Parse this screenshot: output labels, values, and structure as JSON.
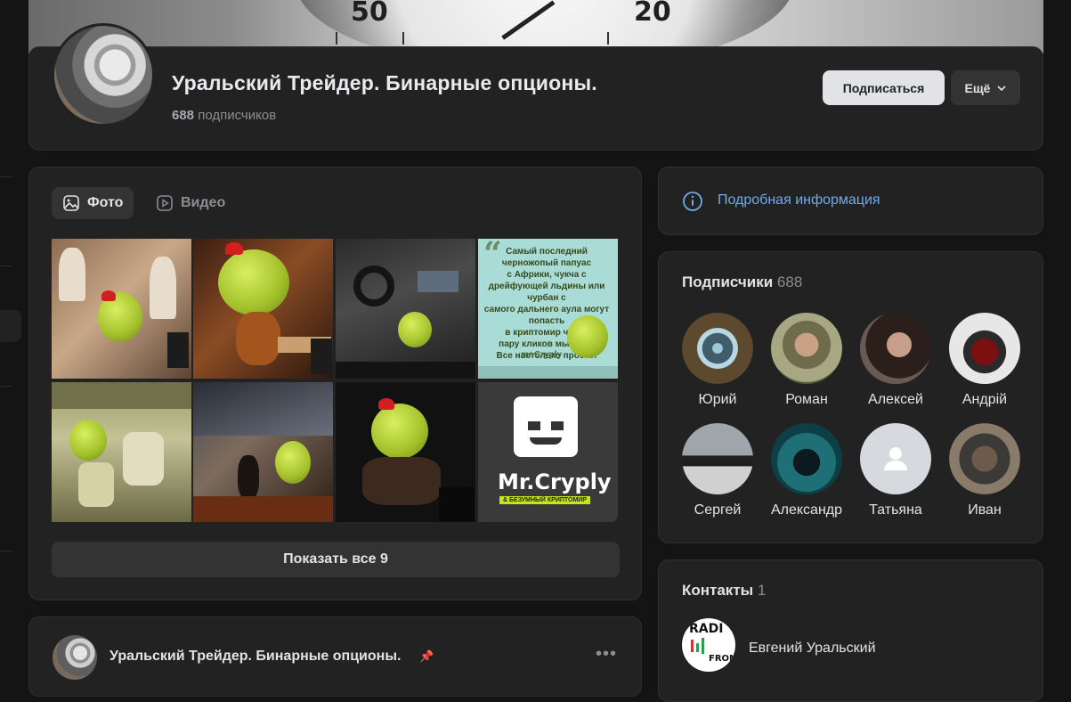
{
  "group": {
    "title": "Уральский Трейдер. Бинарные опционы.",
    "subscribers_count": "688",
    "subscribers_label": "подписчиков",
    "subscribe_button": "Подписаться",
    "more_button": "Ещё"
  },
  "cover": {
    "dial_numbers": [
      "50",
      "20"
    ]
  },
  "media": {
    "tabs": [
      {
        "label": "Фото",
        "icon": "image-icon",
        "active": true
      },
      {
        "label": "Видео",
        "icon": "play-icon",
        "active": false
      }
    ],
    "quote_text": "Самый последний\nчерножопый папуас\nс Африки, чукча с\nдрейфующей льдины или чурбан с\nсамого дальнего аула могут попасть\nв криптомир через\nпару кликов мышкой.\nВсе настолько просто!",
    "quote_sign": "mr.Cryply",
    "logo_text": "Mr.Cryply",
    "logo_sub": "& БЕЗУМНЫЙ КРИПТОМИР",
    "show_all": "Показать все 9"
  },
  "post": {
    "author": "Уральский Трейдер. Бинарные опционы."
  },
  "info": {
    "link": "Подробная информация"
  },
  "members": {
    "title": "Подписчики",
    "count": "688",
    "items": [
      {
        "name": "Юрий"
      },
      {
        "name": "Роман"
      },
      {
        "name": "Алексей"
      },
      {
        "name": "Андрій"
      },
      {
        "name": "Сергей"
      },
      {
        "name": "Александр"
      },
      {
        "name": "Татьяна"
      },
      {
        "name": "Иван"
      }
    ]
  },
  "contacts": {
    "title": "Контакты",
    "count": "1",
    "items": [
      {
        "name": "Евгений Уральский",
        "avatar_text_top": "RADI",
        "avatar_text_bottom": "FROM"
      }
    ]
  },
  "colors": {
    "accent_link": "#71aaeb",
    "card_bg": "#222222",
    "page_bg": "#141414"
  }
}
